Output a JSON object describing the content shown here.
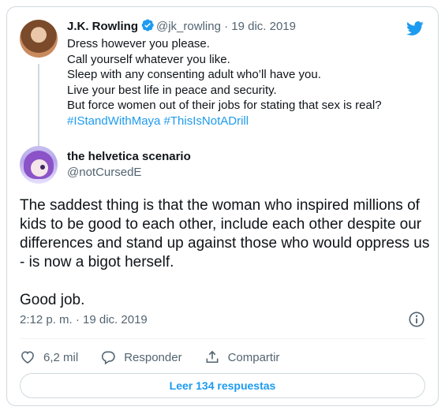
{
  "parent_tweet": {
    "author_name": "J.K. Rowling",
    "handle": "@jk_rowling",
    "separator": "·",
    "date": "19 dic. 2019",
    "lines": [
      "Dress however you please.",
      "Call yourself whatever you like.",
      "Sleep with any consenting adult who’ll have you.",
      "Live your best life in peace and security.",
      "But force women out of their jobs for stating that sex is real?"
    ],
    "hashtags": "#IStandWithMaya #ThisIsNotADrill"
  },
  "reply_tweet": {
    "author_name": "the helvetica scenario",
    "handle": "@notCursedE",
    "paragraph1": "The saddest thing is that the woman who inspired millions of kids to be good to each other, include each other despite our differences and stand up against those who would oppress us - is now a bigot herself.",
    "paragraph2": "Good job.",
    "timestamp": "2:12 p. m. · 19 dic. 2019"
  },
  "actions": {
    "like_count": "6,2 mil",
    "reply_label": "Responder",
    "share_label": "Compartir"
  },
  "read_replies_label": "Leer 134 respuestas",
  "colors": {
    "accent": "#1d9bf0",
    "text": "#0f1419",
    "muted": "#536471",
    "border": "#cfd9de"
  },
  "icons": [
    "twitter-bird-icon",
    "verified-badge-icon",
    "info-icon",
    "heart-icon",
    "reply-bubble-icon",
    "share-icon"
  ]
}
